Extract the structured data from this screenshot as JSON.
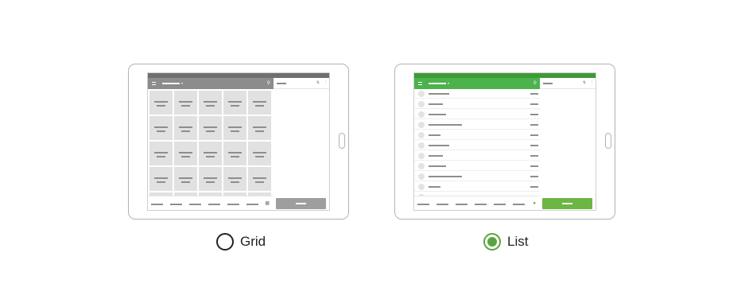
{
  "options": [
    {
      "label": "Grid",
      "selected": false
    },
    {
      "label": "List",
      "selected": true
    }
  ],
  "colors": {
    "accent": "#5aa43f",
    "grid_statusbar": "#6f6f6f",
    "grid_appbar": "#8c8c8c",
    "grid_button": "#9e9e9e",
    "list_statusbar": "#3c9a35",
    "list_appbar": "#4cb24c",
    "list_button": "#6cb644"
  },
  "icons": {
    "menu": "menu-icon",
    "search": "search-icon",
    "sort": "sort-icon",
    "more": "more-vert-icon",
    "grid_view": "grid-view-icon"
  }
}
